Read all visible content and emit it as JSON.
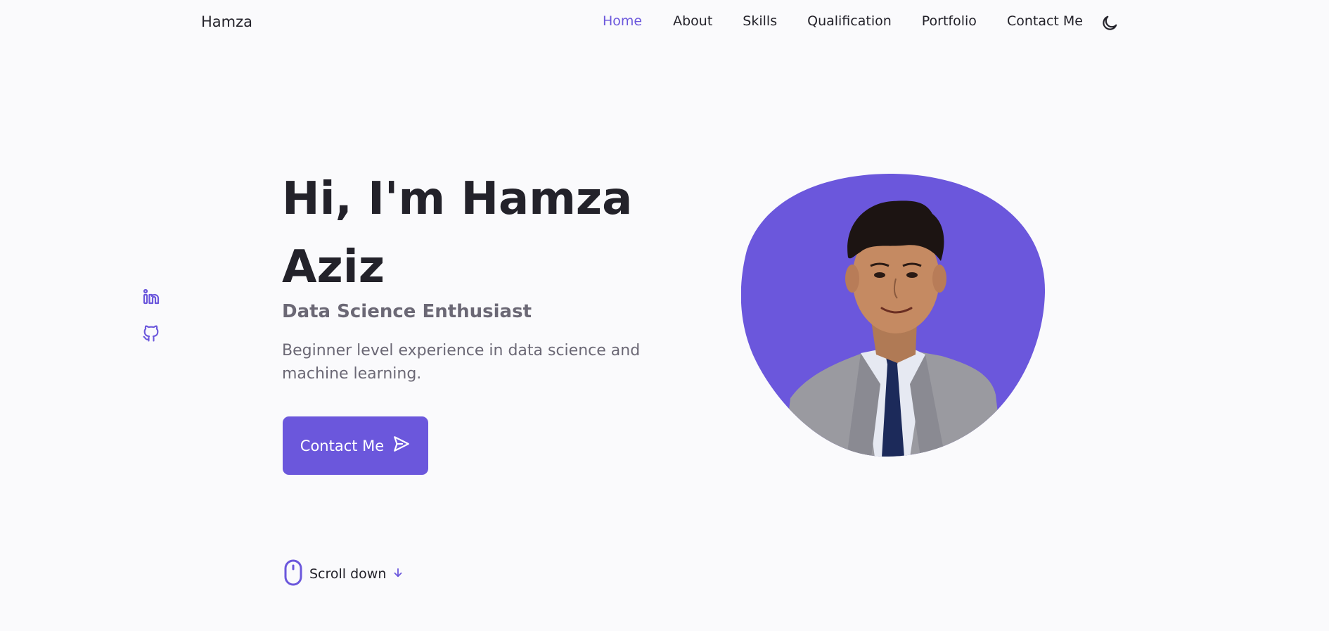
{
  "header": {
    "logo": "Hamza",
    "nav": [
      {
        "label": "Home",
        "active": true
      },
      {
        "label": "About",
        "active": false
      },
      {
        "label": "Skills",
        "active": false
      },
      {
        "label": "Qualification",
        "active": false
      },
      {
        "label": "Portfolio",
        "active": false
      },
      {
        "label": "Contact Me",
        "active": false
      }
    ],
    "theme_icon": "moon-icon"
  },
  "social": [
    {
      "name": "linkedin-icon"
    },
    {
      "name": "github-icon"
    }
  ],
  "hero": {
    "title": "Hi, I'm Hamza Aziz",
    "subtitle": "Data Science Enthusiast",
    "description": "Beginner level experience in data science and machine learning.",
    "button_label": "Contact Me",
    "button_icon": "send-icon",
    "image_icon": "profile-photo"
  },
  "scroll": {
    "label": "Scroll down",
    "mouse_icon": "mouse-icon",
    "arrow_icon": "arrow-down-icon"
  },
  "colors": {
    "accent": "#6b57dc",
    "title": "#23222a",
    "text": "#6b6875",
    "background": "#fafafc"
  }
}
